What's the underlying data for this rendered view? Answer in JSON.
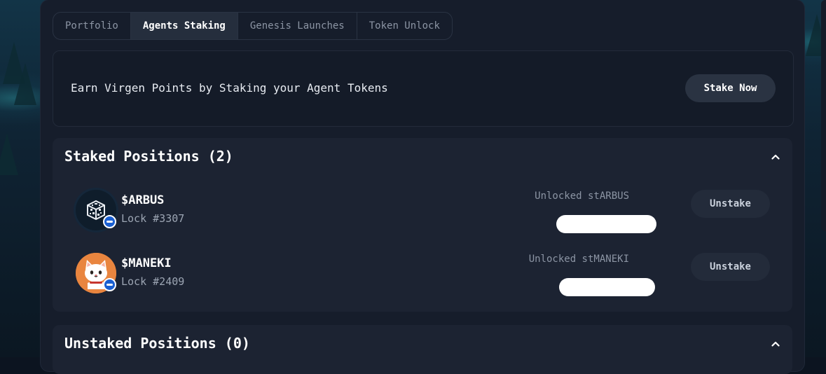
{
  "tabs": [
    {
      "label": "Portfolio",
      "active": false
    },
    {
      "label": "Agents Staking",
      "active": true
    },
    {
      "label": "Genesis Launches",
      "active": false
    },
    {
      "label": "Token Unlock",
      "active": false
    }
  ],
  "promo": {
    "text": "Earn Virgen Points by Staking your Agent Tokens",
    "button_label": "Stake Now"
  },
  "staked": {
    "title": "Staked Positions (2)",
    "positions": [
      {
        "ticker": "$ARBUS",
        "lock": "Lock #3307",
        "unlocked_label": "Unlocked stARBUS",
        "action_label": "Unstake",
        "avatar_icon": "arbus-cube-icon"
      },
      {
        "ticker": "$MANEKI",
        "lock": "Lock #2409",
        "unlocked_label": "Unlocked stMANEKI",
        "action_label": "Unstake",
        "avatar_icon": "maneki-cat-icon"
      }
    ]
  },
  "unstaked": {
    "title": "Unstaked Positions (0)"
  },
  "colors": {
    "panel": "#161d2b",
    "section": "#1c2332",
    "badge": "#1a5fd1",
    "text_primary": "#ffffff",
    "text_muted": "#8c95a4"
  }
}
